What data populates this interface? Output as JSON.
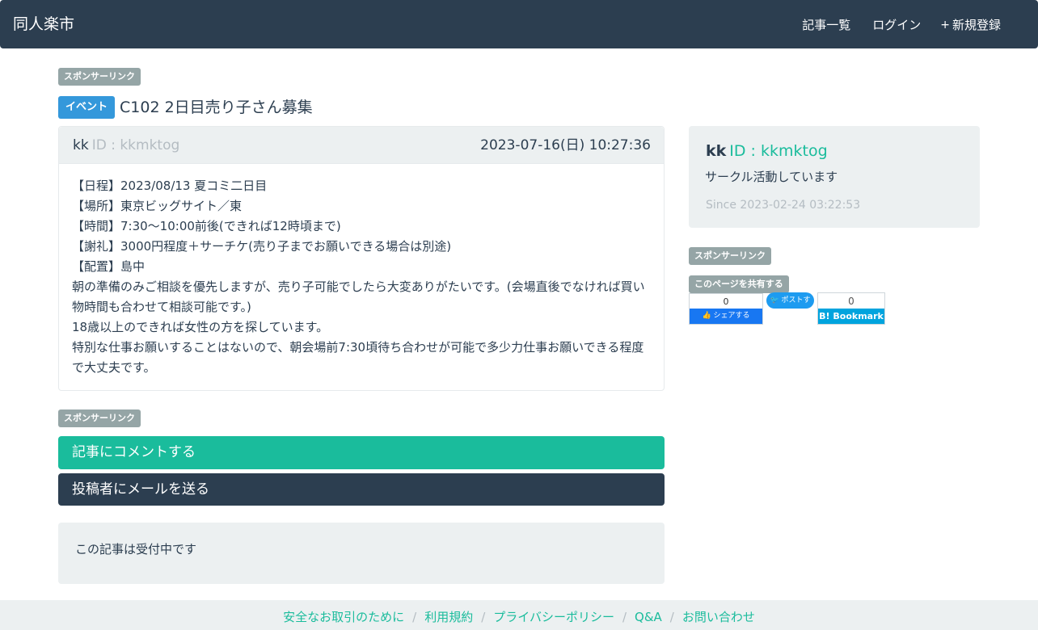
{
  "navbar": {
    "brand": "同人楽市",
    "links": [
      {
        "icon": "list-icon",
        "glyph": "",
        "label": "記事一覧"
      },
      {
        "icon": "login-icon",
        "glyph": "",
        "label": "ログイン"
      },
      {
        "icon": "plus-icon",
        "glyph": "+",
        "label": "新規登録"
      }
    ]
  },
  "sponsor_label": "スポンサーリンク",
  "post": {
    "category": "イベント",
    "title": "C102 2日目売り子さん募集",
    "author_name": "kk",
    "author_id": "ID : kkmktog",
    "date": "2023-07-16(日) 10:27:36",
    "body_lines": [
      "【日程】2023/08/13 夏コミ二日目",
      "【場所】東京ビッグサイト／東",
      "【時間】7:30〜10:00前後(できれば12時頃まで)",
      "【謝礼】3000円程度＋サーチケ(売り子までお願いできる場合は別途)",
      "【配置】島中",
      "朝の準備のみご相談を優先しますが、売り子可能でしたら大変ありがたいです。(会場直後でなければ買い物時間も合わせて相談可能です。)",
      "18歳以上のできれば女性の方を探しています。",
      "特別な仕事お願いすることはないので、朝会場前7:30頃待ち合わせが可能で多少力仕事お願いできる程度で大丈夫です。"
    ]
  },
  "actions": {
    "comment": "記事にコメントする",
    "mail": "投稿者にメールを送る"
  },
  "status": "この記事は受付中です",
  "profile": {
    "name": "kk",
    "id": "ID : kkmktog",
    "description": "サークル活動しています",
    "since": "Since 2023-02-24 03:22:53"
  },
  "share": {
    "label": "このページを共有する",
    "facebook": {
      "count": "0",
      "label": "シェアする"
    },
    "twitter": {
      "label": "ポストする"
    },
    "hatena": {
      "count": "0",
      "label": "B! Bookmark"
    }
  },
  "footer": {
    "links": [
      "安全なお取引のために",
      "利用規約",
      "プライバシーポリシー",
      "Q&A",
      "お問い合わせ"
    ],
    "separator": "/"
  },
  "colors": {
    "navbar": "#2c3e50",
    "accent": "#1abc9c",
    "event_badge": "#3498db",
    "sponsor_badge": "#95a5a6",
    "panel": "#ecf0f1"
  }
}
